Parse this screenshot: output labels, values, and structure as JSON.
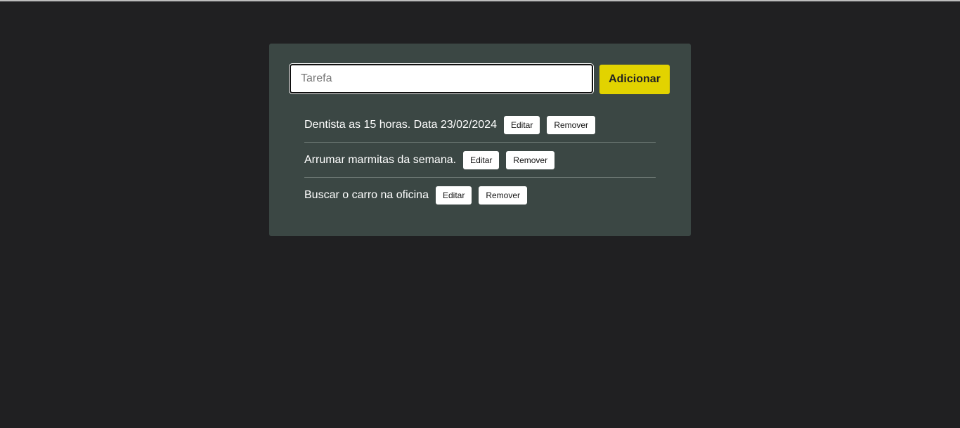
{
  "form": {
    "input_placeholder": "Tarefa",
    "input_value": "",
    "add_label": "Adicionar"
  },
  "tasks": [
    {
      "text": "Dentista as 15 horas. Data 23/02/2024",
      "edit_label": "Editar",
      "remove_label": "Remover"
    },
    {
      "text": "Arrumar marmitas da semana.",
      "edit_label": "Editar",
      "remove_label": "Remover"
    },
    {
      "text": "Buscar o carro na oficina",
      "edit_label": "Editar",
      "remove_label": "Remover"
    }
  ],
  "colors": {
    "background": "#202022",
    "card": "#3b4744",
    "accent": "#e2d300"
  }
}
